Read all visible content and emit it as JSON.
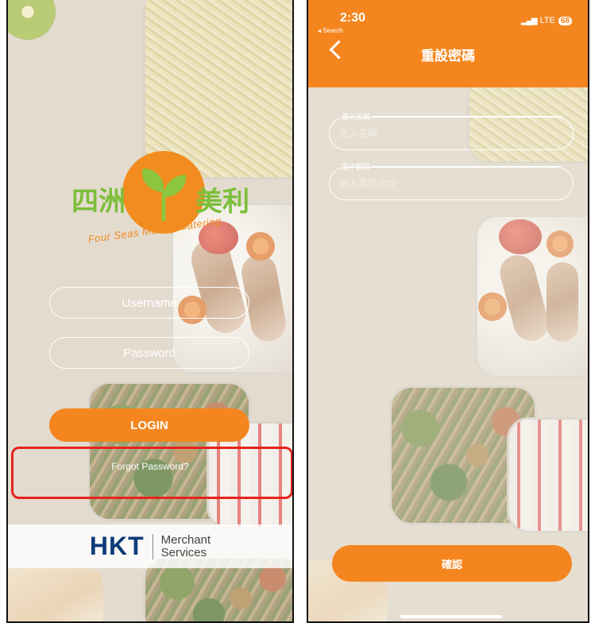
{
  "login_screen": {
    "logo": {
      "cn_left": "四洲",
      "cn_right": "美利",
      "en": "Four Seas Murray Catering"
    },
    "username_placeholder": "Username",
    "password_placeholder": "Password",
    "login_label": "LOGIN",
    "forgot_label": "Forgot Password?",
    "footer": {
      "brand": "HKT",
      "line1": "Merchant",
      "line2": "Services"
    }
  },
  "reset_screen": {
    "status": {
      "time": "2:30",
      "back_app": "◂ Search",
      "network": "LTE",
      "battery": "68"
    },
    "title": "重設密碼",
    "username_label": "登入名稱",
    "username_placeholder": "登入名稱",
    "email_label": "電子郵箱",
    "email_placeholder": "輸入電郵地址",
    "confirm_label": "確認"
  },
  "colors": {
    "brand_orange": "#f5861f",
    "logo_green": "#7cbf3a",
    "highlight_red": "#e5241c",
    "hkt_blue": "#0d3b7a"
  }
}
